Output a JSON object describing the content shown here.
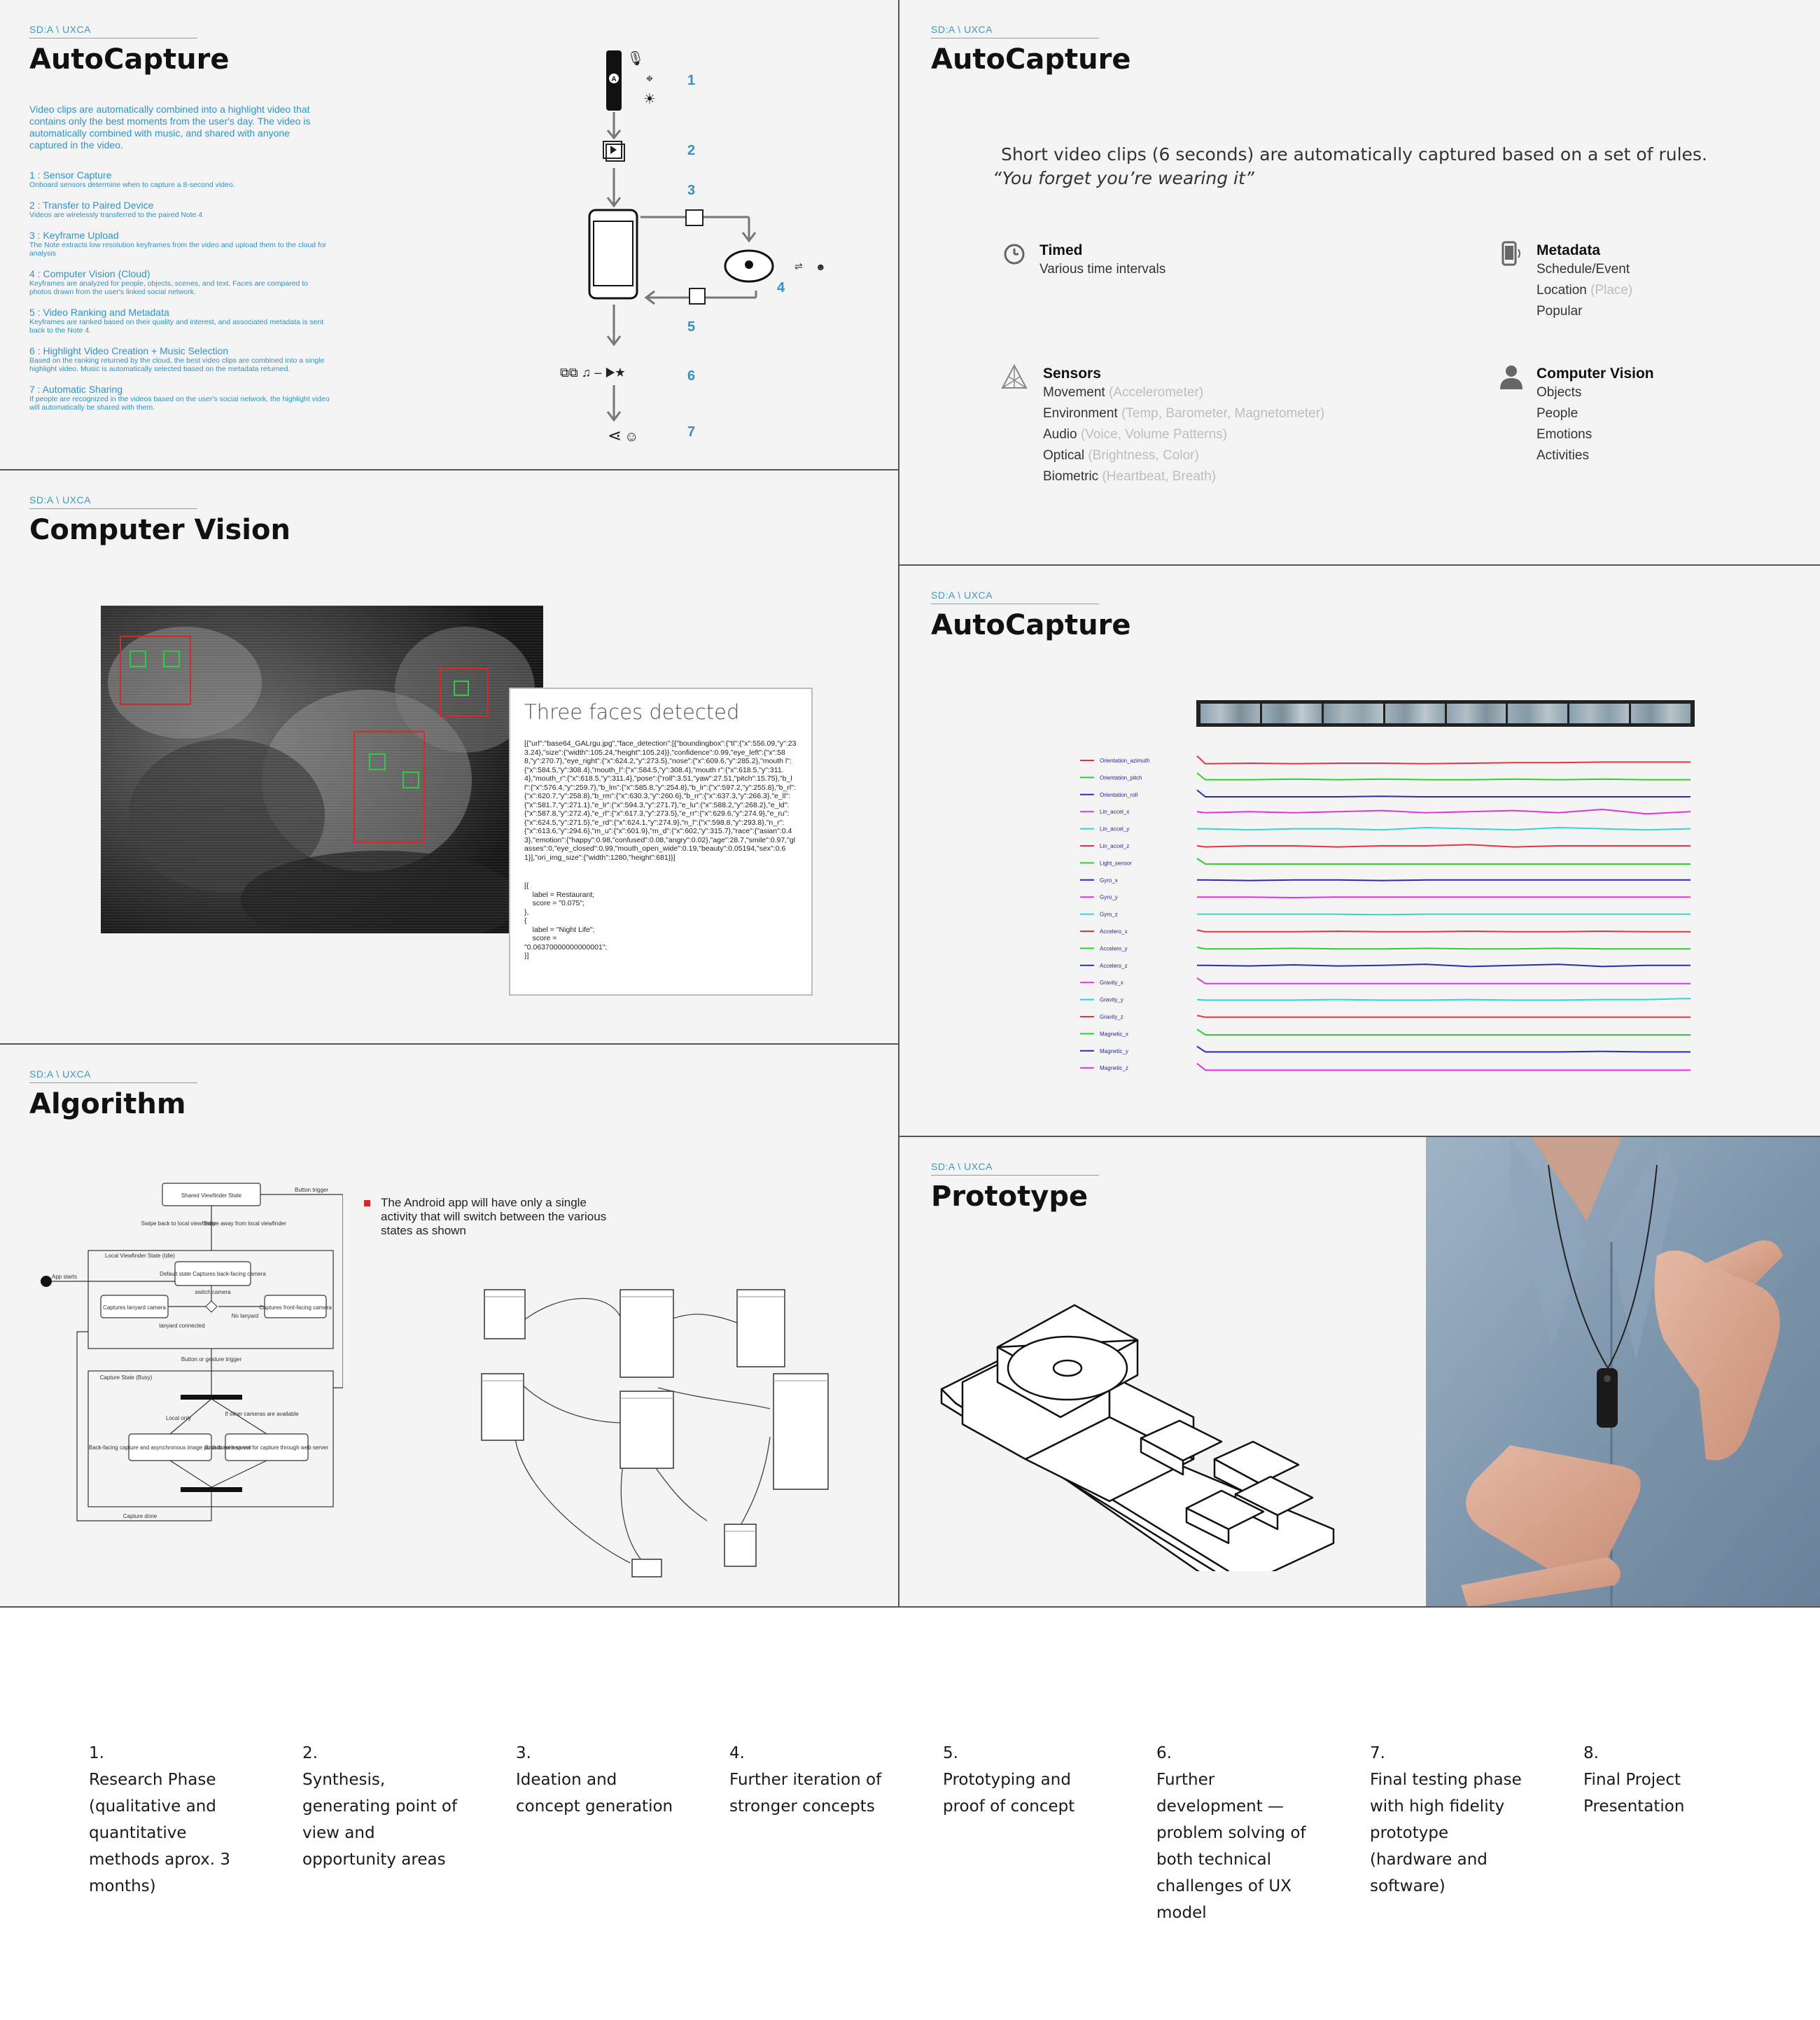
{
  "slides": {
    "autocapture_flow": {
      "tag": "SD:A \\ UXCA",
      "title": "AutoCapture",
      "intro": "Video clips are automatically combined into a highlight video that contains only the best moments from the user's day.  The video is automatically combined with music, and shared with anyone captured in the video.",
      "steps": [
        {
          "title": "1 : Sensor Capture",
          "desc": "Onboard sensors determine when to capture a 8-second video."
        },
        {
          "title": "2 : Transfer to Paired Device",
          "desc": "Videos are wirelessly transferred to the paired Note 4"
        },
        {
          "title": "3 : Keyframe Upload",
          "desc": "The Note extracts low resolution keyframes from the video and upload them to the cloud for analysis"
        },
        {
          "title": "4 : Computer Vision (Cloud)",
          "desc": "Keyframes are analyzed for people, objects, scenes, and text.  Faces are compared to photos drawn from the user's linked social network."
        },
        {
          "title": "5 : Video Ranking and Metadata",
          "desc": "Keyframes are ranked based on their quality and interest, and associated metadata is sent back to the Note 4."
        },
        {
          "title": "6 : Highlight Video Creation + Music Selection",
          "desc": "Based on the ranking returned by the cloud, the best video clips are combined into a single highlight video.  Music is automatically selected based on the metadata returned."
        },
        {
          "title": "7 : Automatic Sharing",
          "desc": "If people are recognized in the videos based on the user's social network, the highlight video will automatically be shared with them."
        }
      ],
      "flow_numbers": [
        "1",
        "2",
        "3",
        "4",
        "5",
        "6",
        "7"
      ]
    },
    "autocapture_rules": {
      "tag": "SD:A \\ UXCA",
      "title": "AutoCapture",
      "lead": "Short video clips (6 seconds) are automatically captured based on a set of rules.",
      "quote": "“You forget you’re wearing it”",
      "timed": {
        "title": "Timed",
        "lines": [
          "Various time intervals"
        ]
      },
      "metadata": {
        "title": "Metadata",
        "lines": [
          [
            "Schedule/Event",
            ""
          ],
          [
            "Location",
            "(Place)"
          ],
          [
            "Popular",
            ""
          ]
        ]
      },
      "sensors": {
        "title": "Sensors",
        "lines": [
          [
            "Movement",
            "(Accelerometer)"
          ],
          [
            "Environment",
            "(Temp, Barometer, Magnetometer)"
          ],
          [
            "Audio",
            "(Voice, Volume Patterns)"
          ],
          [
            "Optical",
            "(Brightness, Color)"
          ],
          [
            "Biometric",
            "(Heartbeat, Breath)"
          ]
        ]
      },
      "cv": {
        "title": "Computer Vision",
        "lines": [
          "Objects",
          "People",
          "Emotions",
          "Activities"
        ]
      }
    },
    "computer_vision": {
      "tag": "SD:A \\ UXCA",
      "title": "Computer Vision",
      "card_title": "Three faces detected",
      "json_text": "[{\"url\":\"base64_GALrgu.jpg\",\"face_detection\":[{\"boundingbox\":{\"tl\":{\"x\":556.09,\"y\":233.24},\"size\":{\"width\":105.24,\"height\":105.24}},\"confidence\":0.99,\"eye_left\":{\"x\":588,\"y\":270.7},\"eye_right\":{\"x\":624.2,\"y\":273.5},\"nose\":{\"x\":609.6,\"y\":285.2},\"mouth l\":{\"x\":584.5,\"y\":308.4},\"mouth_l\":{\"x\":584.5,\"y\":308.4},\"mouth r\":{\"x\":618.5,\"y\":311.4},\"mouth_r\":{\"x\":618.5,\"y\":311.4},\"pose\":{\"roll\":3.51,\"yaw\":27.51,\"pitch\":15.75},\"b_ll\":{\"x\":576.4,\"y\":259.7},\"b_lm\":{\"x\":585.8,\"y\":254.8},\"b_lr\":{\"x\":597.2,\"y\":255.8},\"b_rl\":{\"x\":620.7,\"y\":258.8},\"b_rm\":{\"x\":630.3,\"y\":260.6},\"b_rr\":{\"x\":637.3,\"y\":266.3},\"e_ll\":{\"x\":581.7,\"y\":271.1},\"e_lr\":{\"x\":594.3,\"y\":271.7},\"e_lu\":{\"x\":588.2,\"y\":268.2},\"e_ld\":{\"x\":587.8,\"y\":272.4},\"e_rl\":{\"x\":617.3,\"y\":273.5},\"e_rr\":{\"x\":629.6,\"y\":274.9},\"e_ru\":{\"x\":624.5,\"y\":271.5},\"e_rd\":{\"x\":624.1,\"y\":274.9},\"n_l\":{\"x\":598.8,\"y\":293.8},\"n_r\":{\"x\":613.6,\"y\":294.6},\"m_u\":{\"x\":601.9},\"m_d\":{\"x\":602,\"y\":315.7},\"race\":{\"asian\":0.43},\"emotion\":{\"happy\":0.98,\"confused\":0.08,\"angry\":0.02},\"age\":28.7,\"smile\":0.97,\"glasses\":0,\"eye_closed\":0.99,\"mouth_open_wide\":0.19,\"beauty\":0.05194,\"sex\":0.61}],\"ori_img_size\":{\"width\":1280,\"height\":681}}]",
      "labels_text": "[{\n    label = Restaurant;\n    score = \"0.075\";\n},\n{\n    label = \"Night Life\";\n    score =\n\"0.06370000000000001\";\n}]"
    },
    "sensor_chart": {
      "tag": "SD:A \\ UXCA",
      "title": "AutoCapture"
    },
    "algorithm": {
      "tag": "SD:A \\ UXCA",
      "title": "Algorithm",
      "bullet": "The Android app will have only a single activity that will switch between the various states as shown",
      "diagram_labels": {
        "shared": "Shared Viewfinder State",
        "button_trigger": "Button trigger",
        "swipe_back": "Swipe back to local viewfinder",
        "swipe_away": "Swipe away from local viewfinder",
        "local_state": "Local Viewfinder State (Idle)",
        "app_starts": "App starts",
        "default_state": "Default state\nCaptures back-facing camera",
        "switch_camera": "switch camera",
        "lanyard": "Captures lanyard camera",
        "front": "Captures front-facing camera",
        "lanyard_connected": "lanyard connected",
        "no_lanyard": "No lanyard",
        "button_or_gesture": "Button or gesture trigger",
        "capture_state": "Capture State (Busy)",
        "local_only": "Local only",
        "if_other": "If other cameras are available",
        "back_facing": "Back-facing capture and asynchronous image push to web server",
        "broadcast": "Broadcast request for capture through web server",
        "capture_done": "Capture done"
      }
    },
    "prototype": {
      "tag": "SD:A \\ UXCA",
      "title": "Prototype"
    }
  },
  "chart_data": {
    "type": "line",
    "title": "",
    "series": [
      {
        "name": "Orientation_azimuth",
        "color": "#e8333a",
        "values": [
          0.9,
          0.2,
          0.25,
          0.2,
          0.25,
          0.25,
          0.2,
          0.25,
          0.3,
          0.3,
          0.35,
          0.35,
          0.35
        ]
      },
      {
        "name": "Orientation_pitch",
        "color": "#33cc33",
        "values": [
          0.9,
          0.3,
          0.3,
          0.35,
          0.3,
          0.35,
          0.3,
          0.3,
          0.35,
          0.3,
          0.35,
          0.3,
          0.3
        ]
      },
      {
        "name": "Orientation_roll",
        "color": "#2a2ab4",
        "values": [
          0.9,
          0.3,
          0.3,
          0.3,
          0.3,
          0.35,
          0.3,
          0.3,
          0.3,
          0.3,
          0.3,
          0.3,
          0.3
        ]
      },
      {
        "name": "Lin_accel_x",
        "color": "#e233e2",
        "values": [
          0.5,
          0.4,
          0.5,
          0.4,
          0.5,
          0.6,
          0.4,
          0.5,
          0.6,
          0.4,
          0.7,
          0.3,
          0.5
        ]
      },
      {
        "name": "Lin_accel_y",
        "color": "#33d4d4",
        "values": [
          0.5,
          0.5,
          0.4,
          0.5,
          0.5,
          0.4,
          0.6,
          0.5,
          0.4,
          0.6,
          0.5,
          0.4,
          0.5
        ]
      },
      {
        "name": "Lin_accel_z",
        "color": "#e8333a",
        "values": [
          0.5,
          0.4,
          0.5,
          0.5,
          0.4,
          0.5,
          0.5,
          0.6,
          0.4,
          0.5,
          0.5,
          0.5,
          0.5
        ]
      },
      {
        "name": "Light_sensor",
        "color": "#33cc33",
        "values": [
          0.9,
          0.4,
          0.4,
          0.4,
          0.4,
          0.4,
          0.4,
          0.4,
          0.4,
          0.4,
          0.4,
          0.4,
          0.4
        ]
      },
      {
        "name": "Gyro_x",
        "color": "#2a2ab4",
        "values": [
          0.5,
          0.5,
          0.45,
          0.5,
          0.5,
          0.45,
          0.5,
          0.5,
          0.5,
          0.5,
          0.5,
          0.5,
          0.5
        ]
      },
      {
        "name": "Gyro_y",
        "color": "#e233e2",
        "values": [
          0.5,
          0.5,
          0.5,
          0.45,
          0.5,
          0.5,
          0.5,
          0.5,
          0.5,
          0.5,
          0.5,
          0.5,
          0.5
        ]
      },
      {
        "name": "Gyro_z",
        "color": "#33d4d4",
        "values": [
          0.5,
          0.5,
          0.5,
          0.5,
          0.5,
          0.45,
          0.5,
          0.5,
          0.5,
          0.5,
          0.5,
          0.5,
          0.5
        ]
      },
      {
        "name": "Accelero_x",
        "color": "#e8333a",
        "values": [
          0.6,
          0.45,
          0.45,
          0.45,
          0.5,
          0.45,
          0.45,
          0.5,
          0.45,
          0.45,
          0.5,
          0.45,
          0.45
        ]
      },
      {
        "name": "Accelero_y",
        "color": "#33cc33",
        "values": [
          0.6,
          0.45,
          0.45,
          0.5,
          0.45,
          0.45,
          0.5,
          0.45,
          0.45,
          0.5,
          0.45,
          0.45,
          0.45
        ]
      },
      {
        "name": "Accelero_z",
        "color": "#2a2ab4",
        "values": [
          0.5,
          0.5,
          0.45,
          0.55,
          0.45,
          0.5,
          0.6,
          0.4,
          0.5,
          0.6,
          0.4,
          0.5,
          0.5
        ]
      },
      {
        "name": "Gravity_x",
        "color": "#e233e2",
        "values": [
          0.9,
          0.4,
          0.4,
          0.4,
          0.4,
          0.4,
          0.4,
          0.4,
          0.4,
          0.4,
          0.4,
          0.4,
          0.4
        ]
      },
      {
        "name": "Gravity_y",
        "color": "#33d4d4",
        "values": [
          0.5,
          0.45,
          0.45,
          0.45,
          0.5,
          0.45,
          0.45,
          0.5,
          0.45,
          0.45,
          0.5,
          0.5,
          0.6
        ]
      },
      {
        "name": "Gravity_z",
        "color": "#e8333a",
        "values": [
          0.6,
          0.45,
          0.45,
          0.45,
          0.45,
          0.45,
          0.45,
          0.45,
          0.45,
          0.45,
          0.45,
          0.45,
          0.45
        ]
      },
      {
        "name": "Magnetic_x",
        "color": "#33cc33",
        "values": [
          0.9,
          0.4,
          0.4,
          0.4,
          0.4,
          0.4,
          0.4,
          0.4,
          0.4,
          0.4,
          0.4,
          0.4,
          0.4
        ]
      },
      {
        "name": "Magnetic_y",
        "color": "#2a2ab4",
        "values": [
          0.9,
          0.4,
          0.4,
          0.4,
          0.4,
          0.4,
          0.4,
          0.4,
          0.4,
          0.4,
          0.45,
          0.4,
          0.4
        ]
      },
      {
        "name": "Magnetic_z",
        "color": "#e233e2",
        "values": [
          0.9,
          0.3,
          0.3,
          0.3,
          0.3,
          0.3,
          0.3,
          0.3,
          0.3,
          0.3,
          0.3,
          0.3,
          0.3
        ]
      }
    ]
  },
  "phases": [
    {
      "num": "1.",
      "text": "Research Phase (qualitative and quantitative methods aprox. 3 months)"
    },
    {
      "num": "2.",
      "text": "Synthesis, generating point of view and opportunity areas"
    },
    {
      "num": "3.",
      "text": "Ideation and concept generation"
    },
    {
      "num": "4.",
      "text": "Further iteration of stronger concepts"
    },
    {
      "num": "5.",
      "text": "Prototyping and proof of concept"
    },
    {
      "num": "6.",
      "text": "Further development — problem solving of both technical challenges of UX model"
    },
    {
      "num": "7.",
      "text": "Final testing phase with high fidelity prototype (hardware and software)"
    },
    {
      "num": "8.",
      "text": "Final Project Presentation"
    }
  ],
  "colors": {
    "accent": "#2f93c4",
    "slide_bg": "#f4f4f4",
    "detect_red": "#d42a2a",
    "detect_green": "#2ecc40"
  }
}
